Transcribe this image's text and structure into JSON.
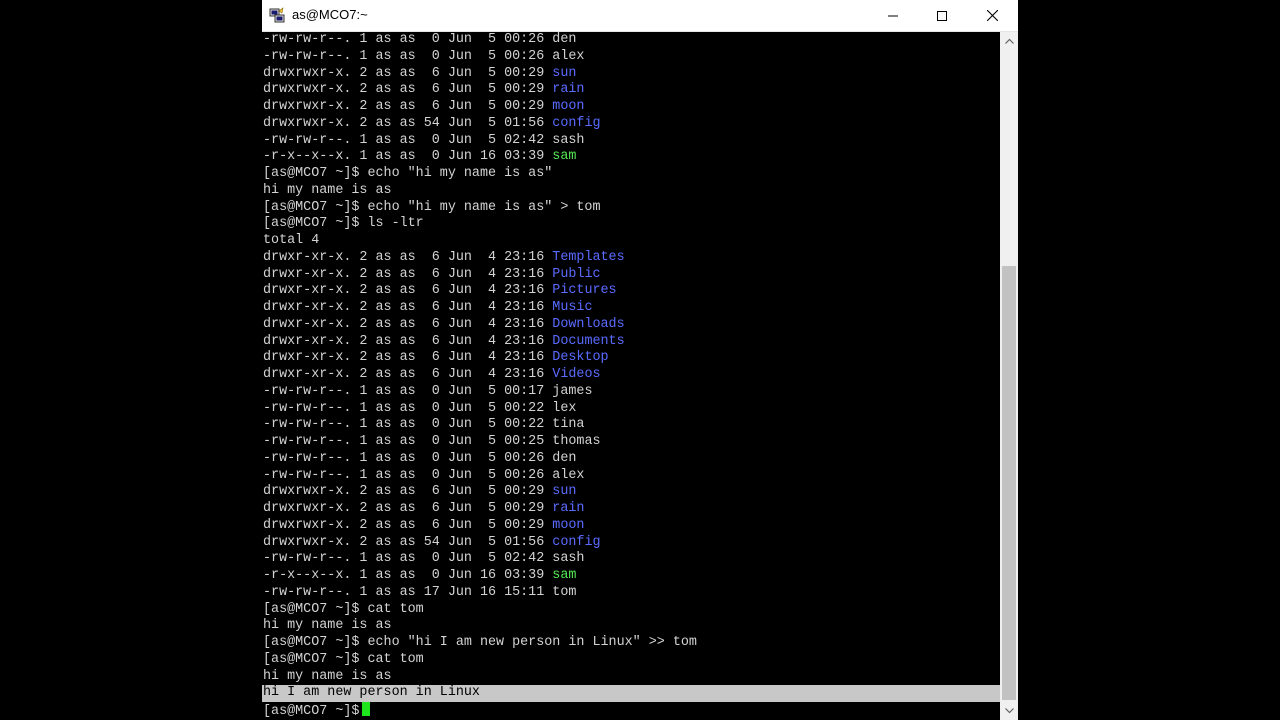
{
  "window": {
    "title": "as@MCO7:~",
    "controls": {
      "minimize_icon": "minimize-icon",
      "maximize_icon": "maximize-icon",
      "close_icon": "close-icon"
    }
  },
  "colors": {
    "directory": "#5a6bff",
    "executable": "#54e854",
    "text": "#d3d3d3",
    "selection": "#c8c8c8",
    "cursor": "#1ee51e"
  },
  "terminal": {
    "lines": [
      {
        "pre": "-rw-rw-r--. 1 as as  0 Jun  5 00:26 ",
        "name": "den",
        "kind": "plain"
      },
      {
        "pre": "-rw-rw-r--. 1 as as  0 Jun  5 00:26 ",
        "name": "alex",
        "kind": "plain"
      },
      {
        "pre": "drwxrwxr-x. 2 as as  6 Jun  5 00:29 ",
        "name": "sun",
        "kind": "dir"
      },
      {
        "pre": "drwxrwxr-x. 2 as as  6 Jun  5 00:29 ",
        "name": "rain",
        "kind": "dir"
      },
      {
        "pre": "drwxrwxr-x. 2 as as  6 Jun  5 00:29 ",
        "name": "moon",
        "kind": "dir"
      },
      {
        "pre": "drwxrwxr-x. 2 as as 54 Jun  5 01:56 ",
        "name": "config",
        "kind": "dir"
      },
      {
        "pre": "-rw-rw-r--. 1 as as  0 Jun  5 02:42 ",
        "name": "sash",
        "kind": "plain"
      },
      {
        "pre": "-r-x--x--x. 1 as as  0 Jun 16 03:39 ",
        "name": "sam",
        "kind": "exec"
      },
      {
        "pre": "[as@MCO7 ~]$ echo \"hi my name is as\"",
        "name": "",
        "kind": "plain"
      },
      {
        "pre": "hi my name is as",
        "name": "",
        "kind": "plain"
      },
      {
        "pre": "[as@MCO7 ~]$ echo \"hi my name is as\" > tom",
        "name": "",
        "kind": "plain"
      },
      {
        "pre": "[as@MCO7 ~]$ ls -ltr",
        "name": "",
        "kind": "plain"
      },
      {
        "pre": "total 4",
        "name": "",
        "kind": "plain"
      },
      {
        "pre": "drwxr-xr-x. 2 as as  6 Jun  4 23:16 ",
        "name": "Templates",
        "kind": "dir"
      },
      {
        "pre": "drwxr-xr-x. 2 as as  6 Jun  4 23:16 ",
        "name": "Public",
        "kind": "dir"
      },
      {
        "pre": "drwxr-xr-x. 2 as as  6 Jun  4 23:16 ",
        "name": "Pictures",
        "kind": "dir"
      },
      {
        "pre": "drwxr-xr-x. 2 as as  6 Jun  4 23:16 ",
        "name": "Music",
        "kind": "dir"
      },
      {
        "pre": "drwxr-xr-x. 2 as as  6 Jun  4 23:16 ",
        "name": "Downloads",
        "kind": "dir"
      },
      {
        "pre": "drwxr-xr-x. 2 as as  6 Jun  4 23:16 ",
        "name": "Documents",
        "kind": "dir"
      },
      {
        "pre": "drwxr-xr-x. 2 as as  6 Jun  4 23:16 ",
        "name": "Desktop",
        "kind": "dir"
      },
      {
        "pre": "drwxr-xr-x. 2 as as  6 Jun  4 23:16 ",
        "name": "Videos",
        "kind": "dir"
      },
      {
        "pre": "-rw-rw-r--. 1 as as  0 Jun  5 00:17 ",
        "name": "james",
        "kind": "plain"
      },
      {
        "pre": "-rw-rw-r--. 1 as as  0 Jun  5 00:22 ",
        "name": "lex",
        "kind": "plain"
      },
      {
        "pre": "-rw-rw-r--. 1 as as  0 Jun  5 00:22 ",
        "name": "tina",
        "kind": "plain"
      },
      {
        "pre": "-rw-rw-r--. 1 as as  0 Jun  5 00:25 ",
        "name": "thomas",
        "kind": "plain"
      },
      {
        "pre": "-rw-rw-r--. 1 as as  0 Jun  5 00:26 ",
        "name": "den",
        "kind": "plain"
      },
      {
        "pre": "-rw-rw-r--. 1 as as  0 Jun  5 00:26 ",
        "name": "alex",
        "kind": "plain"
      },
      {
        "pre": "drwxrwxr-x. 2 as as  6 Jun  5 00:29 ",
        "name": "sun",
        "kind": "dir"
      },
      {
        "pre": "drwxrwxr-x. 2 as as  6 Jun  5 00:29 ",
        "name": "rain",
        "kind": "dir"
      },
      {
        "pre": "drwxrwxr-x. 2 as as  6 Jun  5 00:29 ",
        "name": "moon",
        "kind": "dir"
      },
      {
        "pre": "drwxrwxr-x. 2 as as 54 Jun  5 01:56 ",
        "name": "config",
        "kind": "dir"
      },
      {
        "pre": "-rw-rw-r--. 1 as as  0 Jun  5 02:42 ",
        "name": "sash",
        "kind": "plain"
      },
      {
        "pre": "-r-x--x--x. 1 as as  0 Jun 16 03:39 ",
        "name": "sam",
        "kind": "exec"
      },
      {
        "pre": "-rw-rw-r--. 1 as as 17 Jun 16 15:11 ",
        "name": "tom",
        "kind": "plain"
      },
      {
        "pre": "[as@MCO7 ~]$ cat tom",
        "name": "",
        "kind": "plain"
      },
      {
        "pre": "hi my name is as",
        "name": "",
        "kind": "plain"
      },
      {
        "pre": "[as@MCO7 ~]$ echo \"hi I am new person in Linux\" >> tom",
        "name": "",
        "kind": "plain"
      },
      {
        "pre": "[as@MCO7 ~]$ cat tom",
        "name": "",
        "kind": "plain"
      },
      {
        "pre": "hi my name is as",
        "name": "",
        "kind": "plain"
      },
      {
        "pre": "hi I am new person in Linux",
        "name": "",
        "kind": "selected"
      }
    ],
    "prompt": "[as@MCO7 ~]$ "
  }
}
